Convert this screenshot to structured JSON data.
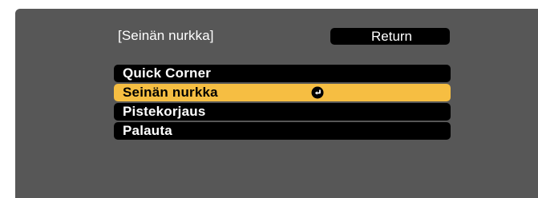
{
  "menu": {
    "title": "[Seinän nurkka]",
    "return_label": "Return",
    "items": [
      {
        "label": "Quick Corner",
        "selected": false
      },
      {
        "label": "Seinän nurkka",
        "selected": true
      },
      {
        "label": "Pistekorjaus",
        "selected": false
      },
      {
        "label": "Palauta",
        "selected": false
      }
    ],
    "selected_icon": "enter-icon"
  },
  "colors": {
    "panel_background": "#575757",
    "item_background": "#000000",
    "selected_background": "#f6be42",
    "text": "#ffffff",
    "selected_text": "#000000"
  }
}
